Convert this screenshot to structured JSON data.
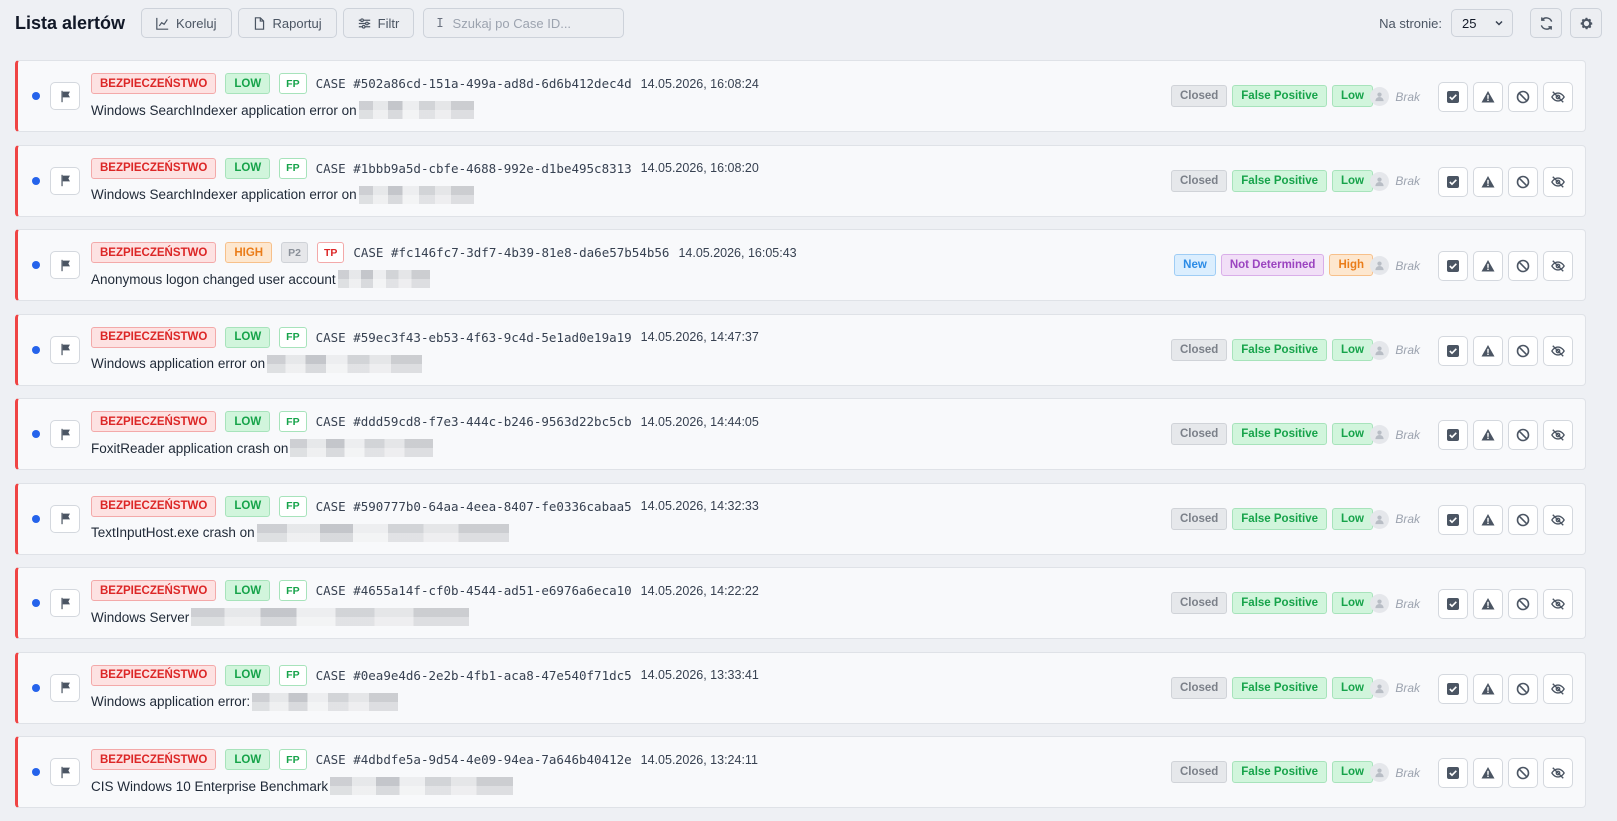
{
  "header": {
    "title": "Lista alertów",
    "buttons": {
      "correlate": "Koreluj",
      "report": "Raportuj",
      "filter": "Filtr"
    },
    "search_placeholder": "Szukaj po Case ID...",
    "per_page_label": "Na stronie:",
    "per_page_value": "25"
  },
  "alerts": [
    {
      "category": "BEZPIECZEŃSTWO",
      "severity": "LOW",
      "verdict": "FP",
      "case_id": "CASE #502a86cd-151a-499a-ad8d-6d6b412dec4d",
      "date": "14.05.2026, 16:08:24",
      "title": "Windows SearchIndexer application error on",
      "status": "Closed",
      "determination": "False Positive",
      "level": "Low",
      "assignee": "Brak"
    },
    {
      "category": "BEZPIECZEŃSTWO",
      "severity": "LOW",
      "verdict": "FP",
      "case_id": "CASE #1bbb9a5d-cbfe-4688-992e-d1be495c8313",
      "date": "14.05.2026, 16:08:20",
      "title": "Windows SearchIndexer application error on",
      "status": "Closed",
      "determination": "False Positive",
      "level": "Low",
      "assignee": "Brak"
    },
    {
      "category": "BEZPIECZEŃSTWO",
      "severity": "HIGH",
      "priority": "P2",
      "verdict": "TP",
      "case_id": "CASE #fc146fc7-3df7-4b39-81e8-da6e57b54b56",
      "date": "14.05.2026, 16:05:43",
      "title": "Anonymous logon changed user account",
      "status": "New",
      "determination": "Not Determined",
      "level": "High",
      "assignee": "Brak"
    },
    {
      "category": "BEZPIECZEŃSTWO",
      "severity": "LOW",
      "verdict": "FP",
      "case_id": "CASE #59ec3f43-eb53-4f63-9c4d-5e1ad0e19a19",
      "date": "14.05.2026, 14:47:37",
      "title": "Windows application error on",
      "status": "Closed",
      "determination": "False Positive",
      "level": "Low",
      "assignee": "Brak"
    },
    {
      "category": "BEZPIECZEŃSTWO",
      "severity": "LOW",
      "verdict": "FP",
      "case_id": "CASE #ddd59cd8-f7e3-444c-b246-9563d22bc5cb",
      "date": "14.05.2026, 14:44:05",
      "title": "FoxitReader application crash on",
      "status": "Closed",
      "determination": "False Positive",
      "level": "Low",
      "assignee": "Brak"
    },
    {
      "category": "BEZPIECZEŃSTWO",
      "severity": "LOW",
      "verdict": "FP",
      "case_id": "CASE #590777b0-64aa-4eea-8407-fe0336cabaa5",
      "date": "14.05.2026, 14:32:33",
      "title": "TextInputHost.exe crash on",
      "status": "Closed",
      "determination": "False Positive",
      "level": "Low",
      "assignee": "Brak"
    },
    {
      "category": "BEZPIECZEŃSTWO",
      "severity": "LOW",
      "verdict": "FP",
      "case_id": "CASE #4655a14f-cf0b-4544-ad51-e6976a6eca10",
      "date": "14.05.2026, 14:22:22",
      "title": "Windows Server",
      "status": "Closed",
      "determination": "False Positive",
      "level": "Low",
      "assignee": "Brak"
    },
    {
      "category": "BEZPIECZEŃSTWO",
      "severity": "LOW",
      "verdict": "FP",
      "case_id": "CASE #0ea9e4d6-2e2b-4fb1-aca8-47e540f71dc5",
      "date": "14.05.2026, 13:33:41",
      "title": "Windows application error:",
      "status": "Closed",
      "determination": "False Positive",
      "level": "Low",
      "assignee": "Brak"
    },
    {
      "category": "BEZPIECZEŃSTWO",
      "severity": "LOW",
      "verdict": "FP",
      "case_id": "CASE #4dbdfe5a-9d54-4e09-94ea-7a646b40412e",
      "date": "14.05.2026, 13:24:11",
      "title": "CIS Windows 10 Enterprise Benchmark",
      "status": "Closed",
      "determination": "False Positive",
      "level": "Low",
      "assignee": "Brak"
    }
  ]
}
